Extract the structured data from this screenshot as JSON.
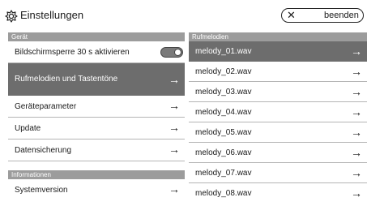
{
  "header": {
    "title": "Einstellungen",
    "close_label": "beenden"
  },
  "left": {
    "section_device": "Gerät",
    "items": [
      {
        "label": "Bildschirmsperre 30 s aktivieren"
      },
      {
        "label": "Rufmelodien und Tastentöne"
      },
      {
        "label": "Geräteparameter"
      },
      {
        "label": "Update"
      },
      {
        "label": "Datensicherung"
      }
    ],
    "section_info": "Informationen",
    "info_items": [
      {
        "label": "Systemversion"
      }
    ]
  },
  "right": {
    "section": "Rufmelodien",
    "items": [
      {
        "label": "melody_01.wav"
      },
      {
        "label": "melody_02.wav"
      },
      {
        "label": "melody_03.wav"
      },
      {
        "label": "melody_04.wav"
      },
      {
        "label": "melody_05.wav"
      },
      {
        "label": "melody_06.wav"
      },
      {
        "label": "melody_07.wav"
      },
      {
        "label": "melody_08.wav"
      }
    ]
  }
}
